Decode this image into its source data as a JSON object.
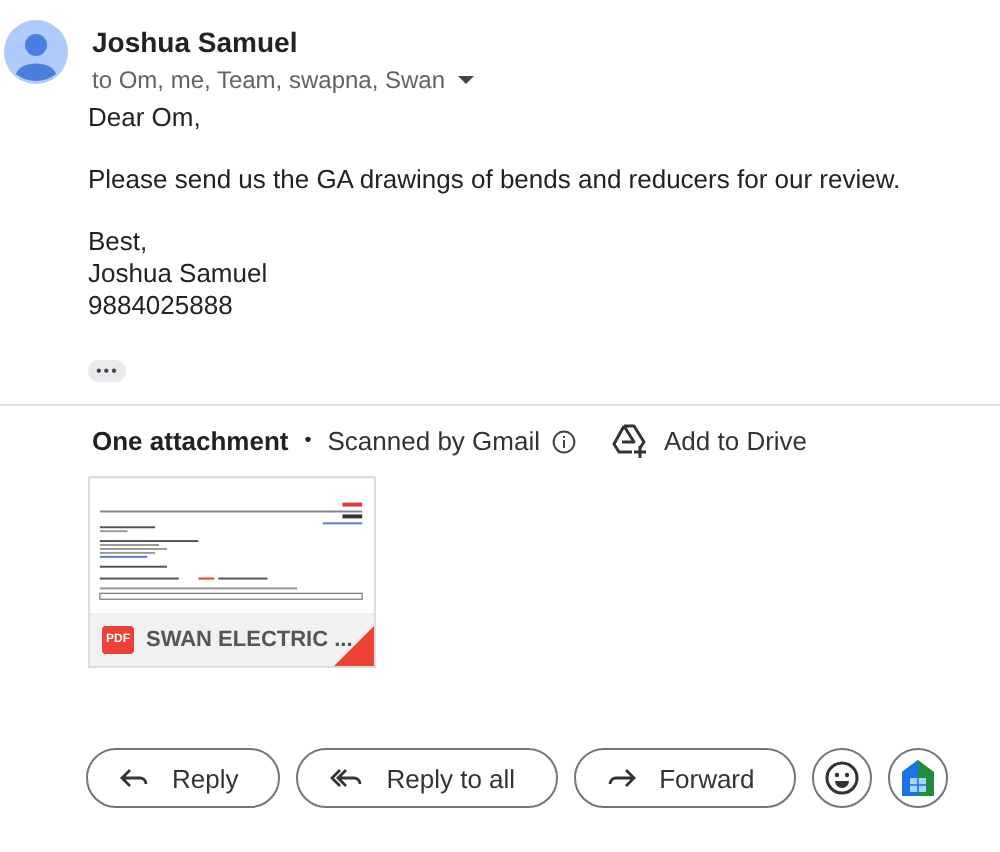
{
  "sender": {
    "name": "Joshua Samuel",
    "recipients": "to Om, me, Team, swapna, Swan"
  },
  "body": [
    "Dear Om,",
    "Please send us the GA drawings of bends and reducers for our review.",
    "Best,\nJoshua Samuel\n9884025888"
  ],
  "ellipsis": "•••",
  "attachments_header": {
    "count": "One attachment",
    "separator": "•",
    "scanned": "Scanned by Gmail",
    "add_to_drive": "Add to Drive"
  },
  "attachments": [
    {
      "type_badge": "PDF",
      "name": "SWAN ELECTRIC ..."
    }
  ],
  "actions": [
    {
      "kind": "reply",
      "label": "Reply"
    },
    {
      "kind": "reply_all",
      "label": "Reply to all"
    },
    {
      "kind": "forward",
      "label": "Forward"
    },
    {
      "kind": "emoji"
    },
    {
      "kind": "sheets"
    }
  ]
}
